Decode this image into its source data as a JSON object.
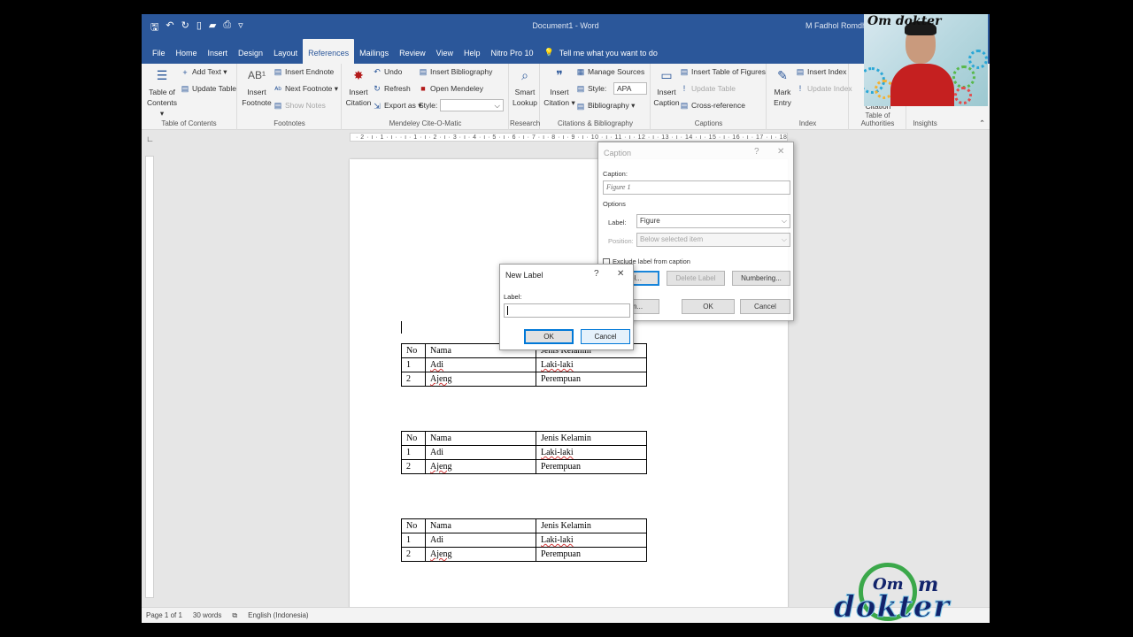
{
  "titlebar": {
    "doc_title": "Document1 - Word",
    "user": "M Fadhol Romdhoni"
  },
  "tabs": [
    "File",
    "Home",
    "Insert",
    "Design",
    "Layout",
    "References",
    "Mailings",
    "Review",
    "View",
    "Help",
    "Nitro Pro 10"
  ],
  "active_tab": "References",
  "tell_me": "Tell me what you want to do",
  "ribbon": {
    "toc": {
      "big_label_1": "Table of",
      "big_label_2": "Contents ▾",
      "add_text": "Add Text ▾",
      "update_table": "Update Table",
      "group": "Table of Contents"
    },
    "footnotes": {
      "ab": "AB¹",
      "big_label_1": "Insert",
      "big_label_2": "Footnote",
      "insert_endnote": "Insert Endnote",
      "next_footnote": "Next Footnote ▾",
      "show_notes": "Show Notes",
      "group": "Footnotes"
    },
    "mendeley": {
      "big_label_1": "Insert",
      "big_label_2": "Citation",
      "undo": "Undo",
      "refresh": "Refresh",
      "export_as": "Export as ▾",
      "style_label": "Style:",
      "insert_bibliography": "Insert Bibliography",
      "open_mendeley": "Open Mendeley",
      "group": "Mendeley Cite-O-Matic"
    },
    "research": {
      "big_label_1": "Smart",
      "big_label_2": "Lookup",
      "group": "Research"
    },
    "citations": {
      "big_label_1": "Insert",
      "big_label_2": "Citation ▾",
      "manage_sources": "Manage Sources",
      "style_label": "Style:",
      "style_value": "APA",
      "bibliography": "Bibliography ▾",
      "group": "Citations & Bibliography"
    },
    "captions": {
      "big_label_1": "Insert",
      "big_label_2": "Caption",
      "insert_tof": "Insert Table of Figures",
      "update_table": "Update Table",
      "cross_reference": "Cross-reference",
      "group": "Captions"
    },
    "index": {
      "big_label_1": "Mark",
      "big_label_2": "Entry",
      "insert_index": "Insert Index",
      "update_index": "Update Index",
      "group": "Index"
    },
    "authorities": {
      "big_label": "Citation",
      "group": "Table of Authorities"
    },
    "insights": {
      "group": "Insights"
    }
  },
  "ruler_text": "· 2 · ı · 1 · ı ·   · ı · 1 · ı · 2 · ı · 3 · ı · 4 · ı · 5 · ı · 6 · ı · 7 · ı · 8 · ı · 9 · ı · 10 · ı · 11 · ı · 12 · ı · 13 · ı · 14 · ı · 15 · ı · 16 · ı · 17 · ı · 18",
  "tables": [
    {
      "rows": [
        [
          "No",
          "Nama",
          "Jenis Kelamin"
        ],
        [
          "1",
          "Adi",
          "Laki-laki"
        ],
        [
          "2",
          "Ajeng",
          "Perempuan"
        ]
      ]
    },
    {
      "rows": [
        [
          "No",
          "Nama",
          "Jenis Kelamin"
        ],
        [
          "1",
          "Adi",
          "Laki-laki"
        ],
        [
          "2",
          "Ajeng",
          "Perempuan"
        ]
      ]
    },
    {
      "rows": [
        [
          "No",
          "Nama",
          "Jenis Kelamin"
        ],
        [
          "1",
          "Adi",
          "Laki-laki"
        ],
        [
          "2",
          "Ajeng",
          "Perempuan"
        ]
      ]
    }
  ],
  "statusbar": {
    "page": "Page 1 of 1",
    "words": "30 words",
    "language": "English (Indonesia)"
  },
  "caption_dialog": {
    "title": "Caption",
    "help": "?",
    "close": "✕",
    "caption_label": "Caption:",
    "caption_value": "Figure 1",
    "options_label": "Options",
    "label_label": "Label:",
    "label_value": "Figure",
    "position_label": "Position:",
    "position_value": "Below selected item",
    "exclude_label": "Exclude label from caption",
    "new_label_btn": "...bel...",
    "delete_label_btn": "Delete Label",
    "numbering_btn": "Numbering...",
    "autocaption_btn": "...tion...",
    "ok": "OK",
    "cancel": "Cancel"
  },
  "new_label_dialog": {
    "title": "New Label",
    "help": "?",
    "close": "✕",
    "label_label": "Label:",
    "label_value": "",
    "ok": "OK",
    "cancel": "Cancel"
  },
  "webcam_logo": "Om dokter",
  "watermark": {
    "top": "Om",
    "m": "m",
    "bottom": "dokter"
  },
  "colors": {
    "word_blue": "#2b579a",
    "ribbon_bg": "#f3f3f3",
    "canvas_bg": "#e6e6e6",
    "accent_focus": "#0078d7",
    "logo_green": "#3ba84a",
    "logo_navy": "#12236b"
  }
}
